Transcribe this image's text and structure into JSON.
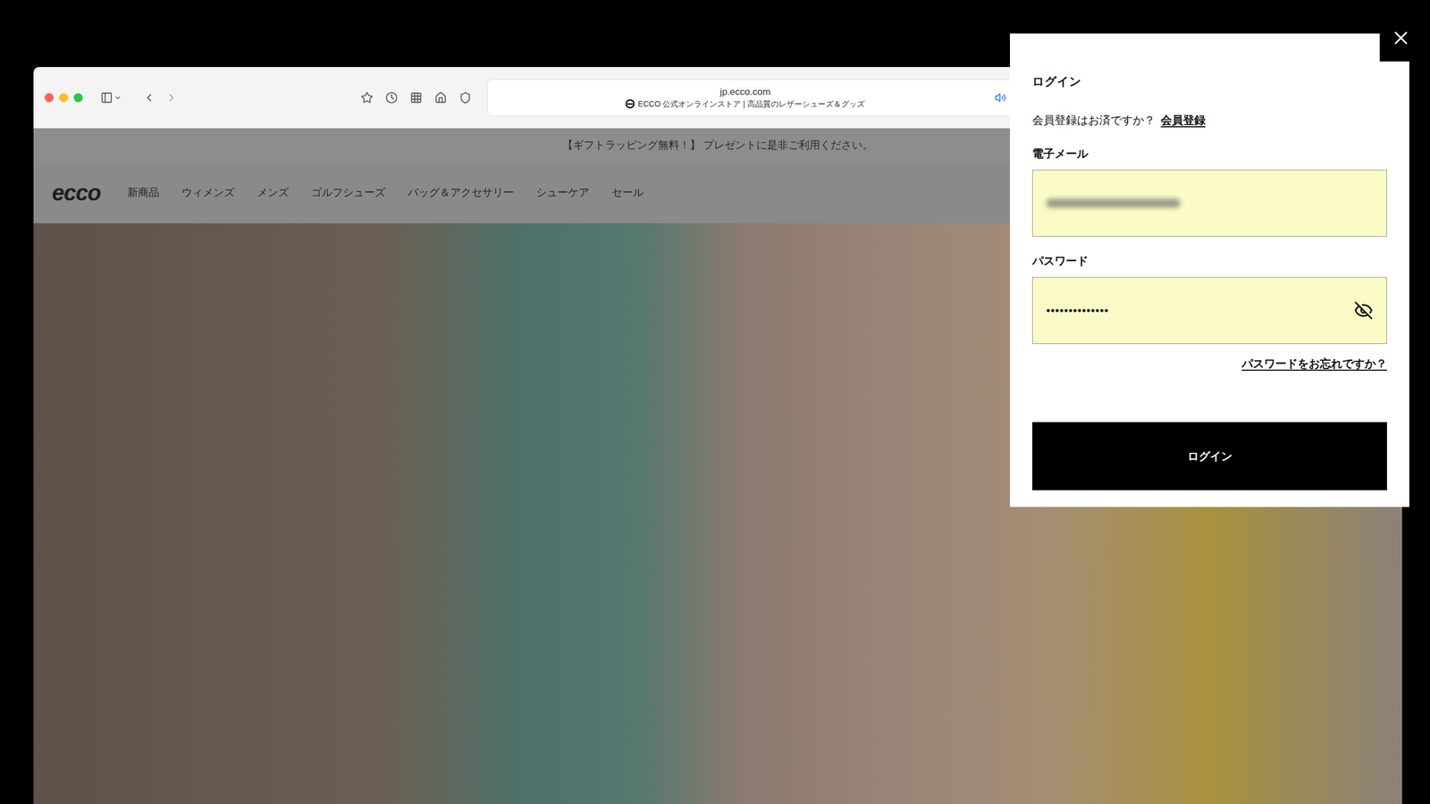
{
  "browser": {
    "url": "jp.ecco.com",
    "page_title": "ECCO 公式オンラインストア | 高品質のレザーシューズ＆グッズ"
  },
  "banner": "【ギフトラッピング無料！】 プレゼントに是非ご利用ください。",
  "site": {
    "logo": "ecco",
    "nav": [
      "新商品",
      "ウィメンズ",
      "メンズ",
      "ゴルフシューズ",
      "バッグ＆アクセサリー",
      "シューケア",
      "セール"
    ]
  },
  "login": {
    "title": "ログイン",
    "register_prompt": "会員登録はお済ですか？",
    "register_link": "会員登録",
    "email": {
      "label": "電子メール",
      "autofilled": true
    },
    "password": {
      "label": "パスワード",
      "value": "••••••••••••••",
      "autofilled": true
    },
    "forgot_link": "パスワードをお忘れですか？",
    "submit": "ログイン"
  }
}
